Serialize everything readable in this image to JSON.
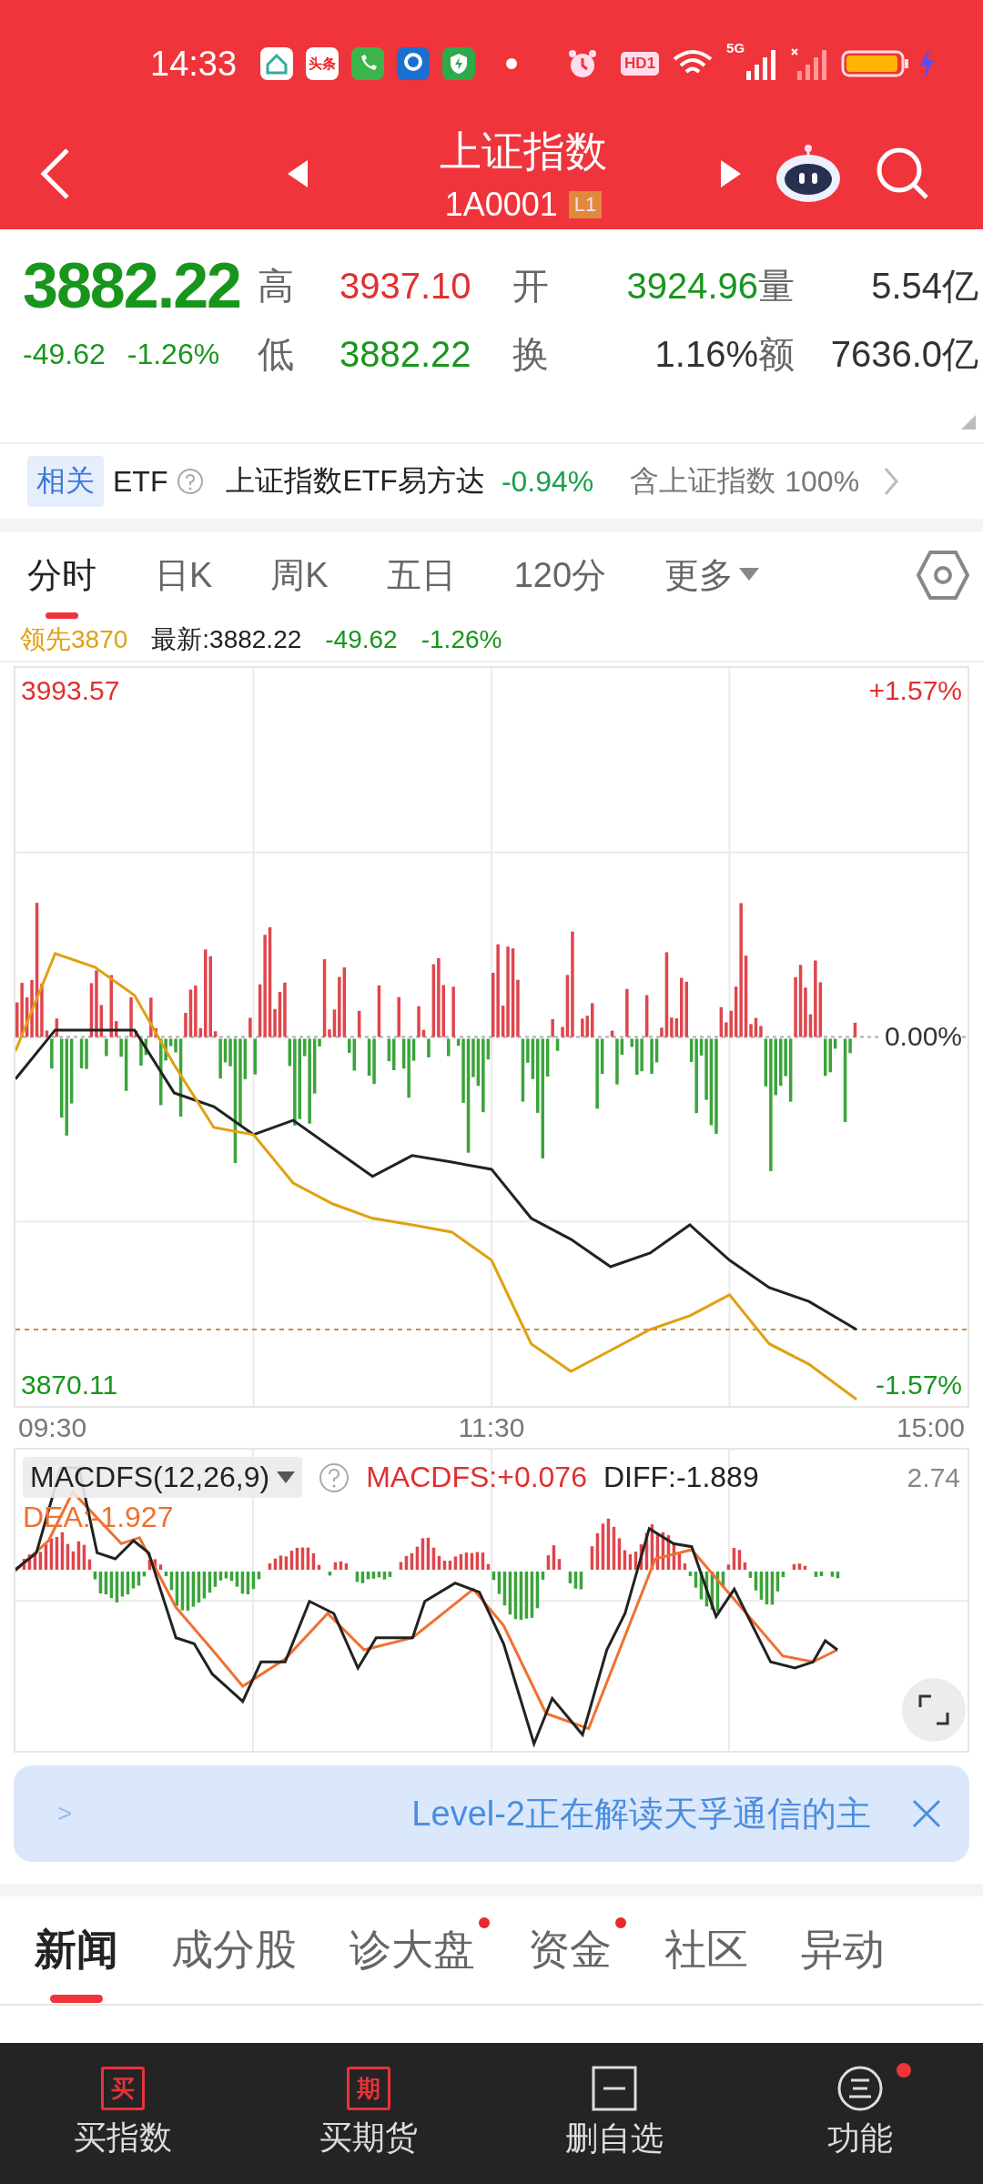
{
  "status_bar": {
    "time": "14:33",
    "news_icon_text": "头条",
    "hd_label": "HD1",
    "network_label": "5G"
  },
  "header": {
    "title": "上证指数",
    "code": "1A0001",
    "level_badge": "L1"
  },
  "quote": {
    "price": "3882.22",
    "color": "#18961c",
    "change": "-49.62",
    "change_pct": "-1.26%",
    "stats": [
      {
        "label": "高",
        "value": "3937.10",
        "color": "#e03030"
      },
      {
        "label": "开",
        "value": "3924.96",
        "color": "#18961c"
      },
      {
        "label": "量",
        "value": "5.54亿",
        "color": "#333333"
      },
      {
        "label": "低",
        "value": "3882.22",
        "color": "#18961c"
      },
      {
        "label": "换",
        "value": "1.16%",
        "color": "#333333"
      },
      {
        "label": "额",
        "value": "7636.0亿",
        "color": "#333333"
      }
    ]
  },
  "etf": {
    "tag": "相关",
    "label": "ETF",
    "name": "上证指数ETF易方达",
    "change": "-0.94%",
    "holding_label": "含上证指数",
    "holding": "100%"
  },
  "chart_tabs": [
    {
      "label": "分时",
      "selected": true,
      "dropdown": false
    },
    {
      "label": "日K",
      "selected": false,
      "dropdown": false
    },
    {
      "label": "周K",
      "selected": false,
      "dropdown": false
    },
    {
      "label": "五日",
      "selected": false,
      "dropdown": false
    },
    {
      "label": "120分",
      "selected": false,
      "dropdown": false
    },
    {
      "label": "更多",
      "selected": false,
      "dropdown": true
    }
  ],
  "info_line": {
    "leader": "领先3870",
    "latest": "最新:3882.22",
    "change": "-49.62",
    "change_pct": "-1.26%"
  },
  "intraday": {
    "high_label": "3993.57",
    "low_label": "3870.11",
    "pct_labels": [
      "+1.57%",
      "0.00%",
      "-1.57%"
    ],
    "time_labels": [
      "09:30",
      "11:30",
      "15:00"
    ]
  },
  "macd": {
    "indicator": "MACDFS(12,26,9)",
    "macd": "MACDFS:+0.076",
    "diff": "DIFF:-1.889",
    "dea": "DEA:-1.927",
    "scale": "2.74"
  },
  "banner": {
    "arrow": ">",
    "text": "Level-2正在解读天孚通信的主"
  },
  "news_tabs": [
    {
      "label": "新闻",
      "selected": true,
      "dot": false
    },
    {
      "label": "成分股",
      "selected": false,
      "dot": false
    },
    {
      "label": "诊大盘",
      "selected": false,
      "dot": true
    },
    {
      "label": "资金",
      "selected": false,
      "dot": true
    },
    {
      "label": "社区",
      "selected": false,
      "dot": false
    },
    {
      "label": "异动",
      "selected": false,
      "dot": false
    }
  ],
  "bottom_nav": [
    {
      "kind": "text",
      "icon_text": "买",
      "label": "买指数",
      "badge": false
    },
    {
      "kind": "text",
      "icon_text": "期",
      "label": "买期货",
      "badge": false
    },
    {
      "kind": "minus",
      "label": "删自选",
      "badge": false
    },
    {
      "kind": "menu",
      "label": "功能",
      "badge": true
    }
  ]
}
